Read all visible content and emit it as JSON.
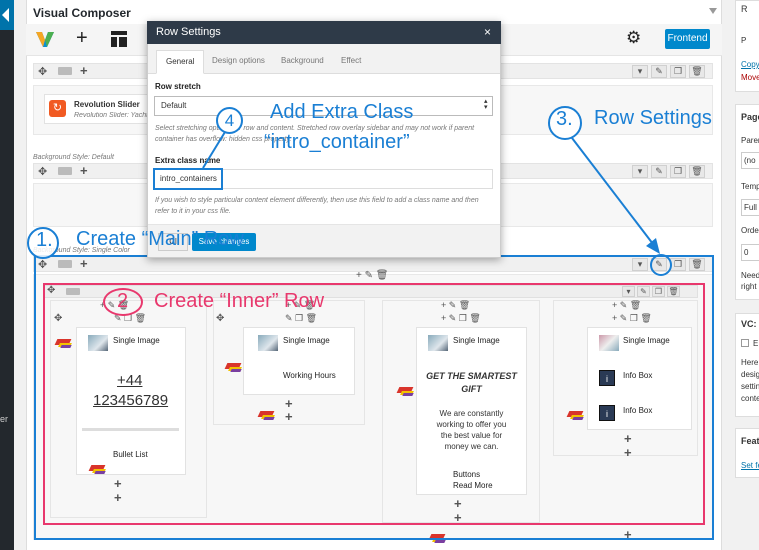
{
  "editor": {
    "title": "Visual Composer",
    "frontend_label": "Frontend",
    "toolbar_icons": [
      "vc-logo-icon",
      "add-element-icon",
      "templates-icon",
      "settings-gear-icon"
    ]
  },
  "rows": {
    "revolution_slider": {
      "title": "Revolution Slider",
      "subtitle": "Revolution Slider: Yacht R"
    },
    "background_default": "Background Style: Default",
    "background_single": "Background Style: Single Color"
  },
  "modal": {
    "title": "Row Settings",
    "close": "×",
    "tabs": [
      "General",
      "Design options",
      "Background",
      "Effect"
    ],
    "row_stretch": {
      "label": "Row stretch",
      "value": "Default",
      "help": "Select stretching options for row and content. Stretched row overlay sidebar and may not work if parent container has overflow: hidden css property."
    },
    "extra_class": {
      "label": "Extra class name",
      "value": "intro_containers",
      "help": "If you wish to style particular content element differently, then use this field to add a class name and then refer to it in your css file."
    },
    "close_label": "Cl",
    "save_label": "Save changes"
  },
  "annotations": {
    "step1_num": "1.",
    "step1_text": "Create “Main” Row",
    "step2_num": "2",
    "step2_text": "Create “Inner” Row",
    "step3_num": "3.",
    "step3_text": "Row Settings",
    "step4_num": "4",
    "step4_text1": "Add Extra Class",
    "step4_text2": "“intro_container”"
  },
  "columns": [
    {
      "items": [
        {
          "icon": "single-image-icon",
          "label": "Single Image"
        },
        {
          "text_line1": "+44",
          "text_line2": "123456789"
        },
        {
          "icon": "bullet-list-icon",
          "label": "Bullet List"
        }
      ]
    },
    {
      "items": [
        {
          "icon": "single-image-icon",
          "label": "Single Image"
        },
        {
          "icon": "working-hours-icon",
          "label": "Working Hours"
        }
      ]
    },
    {
      "items": [
        {
          "icon": "single-image-icon",
          "label": "Single Image"
        },
        {
          "heading_line1": "GET THE SMARTEST",
          "heading_line2": "GIFT",
          "body": [
            "We are constantly",
            "working to offer you",
            "the best value for",
            "money we can."
          ]
        },
        {
          "icon": "buttons-icon",
          "label_line1": "Buttons",
          "label_line2": "Read More"
        }
      ]
    },
    {
      "items": [
        {
          "icon": "single-image-icon",
          "label": "Single Image"
        },
        {
          "icon": "info-box-icon",
          "label": "Info Box"
        },
        {
          "icon": "info-box-icon",
          "label": "Info Box"
        }
      ]
    }
  ],
  "sidebar": {
    "items": [
      "R",
      "P",
      "Copy",
      "Move",
      "Page",
      "Paren",
      "(no",
      "Temp",
      "Full",
      "Orde",
      "0",
      "Need",
      "right",
      "VC: C",
      "E",
      "Here",
      "desig",
      "settin",
      "conte",
      "Featu",
      "Set fe"
    ]
  },
  "left_strip_text": "er",
  "colors": {
    "annotation_blue": "#1a7fd4",
    "annotation_pink": "#e8386d",
    "vc_blue": "#0088cc",
    "modal_header": "#2e3a48"
  }
}
